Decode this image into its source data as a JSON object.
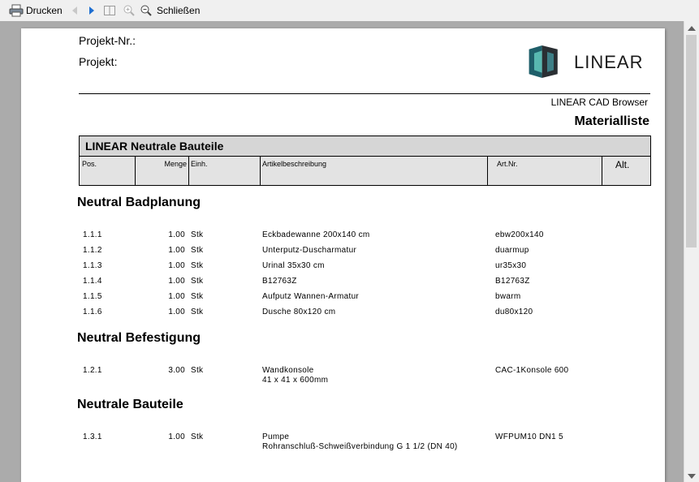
{
  "toolbar": {
    "print_label": "Drucken",
    "close_label": "Schließen"
  },
  "header": {
    "project_nr_label": "Projekt-Nr.:",
    "project_label": "Projekt:",
    "logo_text": "LINEAR",
    "browser_label": "LINEAR CAD Browser",
    "doc_title": "Materialliste"
  },
  "table": {
    "title": "LINEAR Neutrale Bauteile",
    "columns": [
      "Pos.",
      "Menge",
      "Einh.",
      "Artikelbeschreibung",
      "Art.Nr.",
      "Alt."
    ]
  },
  "sections": [
    {
      "title": "Neutral Badplanung",
      "rows": [
        {
          "pos": "1.1.1",
          "qty": "1.00",
          "unit": "Stk",
          "desc": "Eckbadewanne 200x140 cm",
          "art": "ebw200x140"
        },
        {
          "pos": "1.1.2",
          "qty": "1.00",
          "unit": "Stk",
          "desc": "Unterputz-Duscharmatur",
          "art": "duarmup"
        },
        {
          "pos": "1.1.3",
          "qty": "1.00",
          "unit": "Stk",
          "desc": "Urinal 35x30 cm",
          "art": "ur35x30"
        },
        {
          "pos": "1.1.4",
          "qty": "1.00",
          "unit": "Stk",
          "desc": "B12763Z",
          "art": "B12763Z"
        },
        {
          "pos": "1.1.5",
          "qty": "1.00",
          "unit": "Stk",
          "desc": "Aufputz Wannen-Armatur",
          "art": "bwarm"
        },
        {
          "pos": "1.1.6",
          "qty": "1.00",
          "unit": "Stk",
          "desc": "Dusche 80x120 cm",
          "art": "du80x120"
        }
      ]
    },
    {
      "title": "Neutral Befestigung",
      "rows": [
        {
          "pos": "1.2.1",
          "qty": "3.00",
          "unit": "Stk",
          "desc": "Wandkonsole",
          "desc2": "41 x 41 x 600mm",
          "art": "CAC-1Konsole 600"
        }
      ]
    },
    {
      "title": "Neutrale Bauteile",
      "rows": [
        {
          "pos": "1.3.1",
          "qty": "1.00",
          "unit": "Stk",
          "desc": "Pumpe",
          "desc2": "Rohranschluß-Schweißverbindung G 1 1/2  (DN 40)",
          "art": "WFPUM10  DN1 5"
        }
      ]
    }
  ],
  "colors": {
    "viewer_bg": "#ababab",
    "table_header_bg": "#d6d6d6",
    "nav_arrow": "#1f6fd1"
  }
}
